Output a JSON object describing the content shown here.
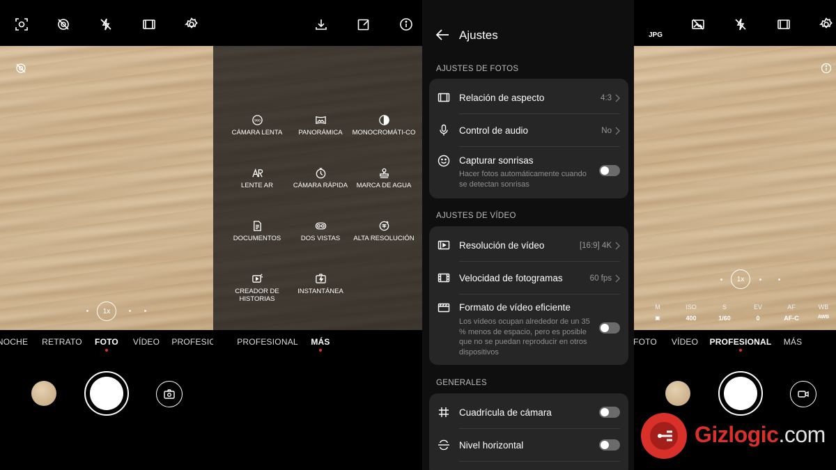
{
  "panel1": {
    "modes": [
      "NOCHE",
      "RETRATO",
      "FOTO",
      "VÍDEO",
      "PROFESIOEO"
    ],
    "active_mode": "FOTO",
    "zoom": "1x",
    "icons": [
      "ai-scene-icon",
      "motion-photo-off-icon",
      "flash-off-icon",
      "aspect-ratio-icon",
      "settings-gear-icon"
    ]
  },
  "panel2": {
    "modes": [
      "PROFESIONAL",
      "MÁS"
    ],
    "active_mode": "MÁS",
    "items": [
      {
        "label": "CÁMARA LENTA",
        "icon": "slow-motion-icon"
      },
      {
        "label": "PANORÁMICA",
        "icon": "panorama-icon"
      },
      {
        "label": "MONOCROMÁTI-CO",
        "icon": "monochrome-icon"
      },
      {
        "label": "LENTE AR",
        "icon": "ar-lens-icon"
      },
      {
        "label": "CÁMARA RÁPIDA",
        "icon": "timelapse-icon"
      },
      {
        "label": "MARCA DE AGUA",
        "icon": "watermark-stamp-icon"
      },
      {
        "label": "DOCUMENTOS",
        "icon": "document-icon"
      },
      {
        "label": "DOS VISTAS",
        "icon": "dual-view-icon"
      },
      {
        "label": "ALTA RESOLUCIÓN",
        "icon": "high-res-icon"
      },
      {
        "label": "CREADOR DE HISTORIAS",
        "icon": "story-creator-icon"
      },
      {
        "label": "INSTANTÁNEA",
        "icon": "snapshot-icon"
      }
    ]
  },
  "settings": {
    "title": "Ajustes",
    "sections": {
      "photo": "AJUSTES DE FOTOS",
      "video": "AJUSTES DE VÍDEO",
      "general": "GENERALES"
    },
    "photo_rows": {
      "aspect": {
        "label": "Relación de aspecto",
        "value": "4:3"
      },
      "audio": {
        "label": "Control de audio",
        "value": "No"
      },
      "smile": {
        "label": "Capturar sonrisas",
        "sub": "Hacer fotos automáticamente cuando se detectan sonrisas",
        "toggle": false
      }
    },
    "video_rows": {
      "resolution": {
        "label": "Resolución de vídeo",
        "value": "[16:9] 4K"
      },
      "fps": {
        "label": "Velocidad de fotogramas",
        "value": "60 fps"
      },
      "efficient": {
        "label": "Formato de vídeo eficiente",
        "sub": "Los vídeos ocupan alrededor de un 35 % menos de espacio, pero es posible que no se puedan reproducir en otros dispositivos",
        "toggle": false
      }
    },
    "general_rows": {
      "grid": {
        "label": "Cuadrícula de cámara",
        "toggle": false
      },
      "level": {
        "label": "Nivel horizontal",
        "toggle": false
      }
    }
  },
  "panel4": {
    "format_label": "JPG",
    "modes": [
      "FOTO",
      "VÍDEO",
      "PROFESIONAL",
      "MÁS"
    ],
    "active_mode": "PROFESIONAL",
    "zoom": "1x",
    "pro_params": [
      {
        "label": "M",
        "value": "▣"
      },
      {
        "label": "ISO",
        "value": "400"
      },
      {
        "label": "S",
        "value": "1/60"
      },
      {
        "label": "EV",
        "value": "0"
      },
      {
        "label": "AF",
        "value": "AF-C"
      },
      {
        "label": "WB",
        "value": "AWB"
      }
    ]
  },
  "watermark": {
    "brand": "Gizlogic",
    "tld": ".com"
  },
  "colors": {
    "accent_red": "#e0302a",
    "card": "#262626",
    "brand_red": "#d9302a"
  }
}
